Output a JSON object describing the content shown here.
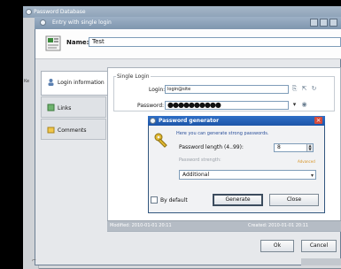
{
  "outer_window": {
    "title": "Password Database",
    "side_text": "Ke"
  },
  "entry_window": {
    "title": "Entry with single login"
  },
  "header": {
    "name_label": "Name:",
    "name_value": "Test"
  },
  "tabs": [
    {
      "label": "Login information"
    },
    {
      "label": "Links"
    },
    {
      "label": "Comments"
    }
  ],
  "single_login": {
    "legend": "Single Login",
    "login_label": "Login:",
    "login_value": "login@site",
    "password_label": "Password:",
    "password_value": "●●●●●●●●●●"
  },
  "password_generator": {
    "title": "Password generator",
    "description": "Here you can generate strong passwords.",
    "length_label": "Password length (4..99):",
    "length_value": "8",
    "strength_label": "Password strength:",
    "strength_link": "Advanced",
    "combo_value": "Additional",
    "by_default_label": "By default",
    "generate_label": "Generate",
    "close_label": "Close"
  },
  "status": {
    "modified": "Modified: 2010-01-01 20:11",
    "created": "Created: 2010-01-01 20:11"
  },
  "buttons": {
    "ok": "Ok",
    "cancel": "Cancel"
  },
  "colors": {
    "title_blue": "#1d55a8",
    "link_orange": "#d6911f"
  }
}
